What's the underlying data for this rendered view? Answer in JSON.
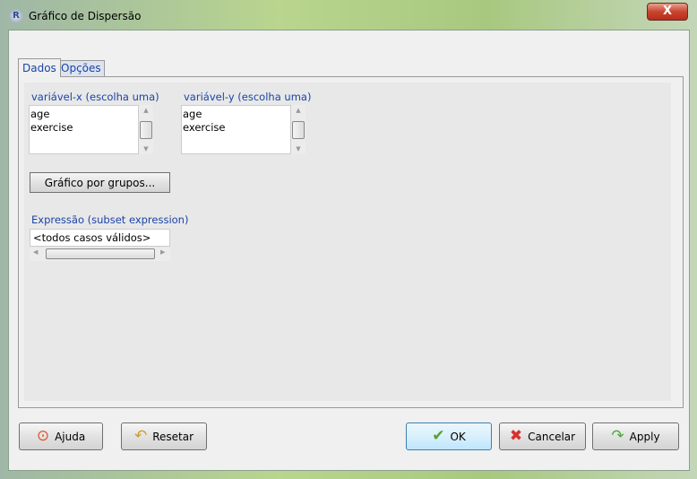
{
  "window": {
    "title": "Gráfico de Dispersão",
    "close": "X",
    "app_icon": "R"
  },
  "tabs": [
    {
      "label": "Dados",
      "active": true
    },
    {
      "label": "Opções",
      "active": false
    }
  ],
  "x_var": {
    "label": "variável-x (escolha uma)",
    "items": [
      "age",
      "exercise"
    ]
  },
  "y_var": {
    "label": "variável-y (escolha uma)",
    "items": [
      "age",
      "exercise"
    ]
  },
  "group_button": "Gráfico por grupos...",
  "subset": {
    "label": "Expressão (subset expression)",
    "value": "<todos casos válidos>"
  },
  "buttons": {
    "help": "Ajuda",
    "reset": "Resetar",
    "ok": "OK",
    "cancel": "Cancelar",
    "apply": "Apply"
  },
  "icons": {
    "help": "lifebuoy-icon",
    "reset": "undo-arrow-icon",
    "ok": "checkmark-icon",
    "cancel": "red-x-icon",
    "apply": "redo-arrow-icon"
  }
}
